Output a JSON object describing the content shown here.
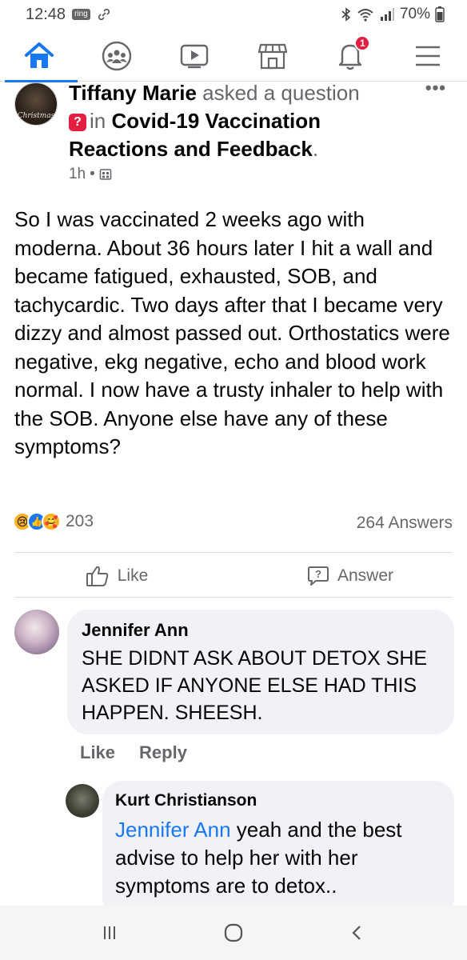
{
  "status_bar": {
    "time": "12:48",
    "ring_label": "ring",
    "battery": "70%"
  },
  "nav": {
    "tabs": [
      {
        "name": "home",
        "icon": "home-icon",
        "active": true
      },
      {
        "name": "groups",
        "icon": "groups-icon",
        "active": false
      },
      {
        "name": "watch",
        "icon": "video-icon",
        "active": false
      },
      {
        "name": "marketplace",
        "icon": "marketplace-icon",
        "active": false
      },
      {
        "name": "notifications",
        "icon": "bell-icon",
        "active": false
      },
      {
        "name": "menu",
        "icon": "menu-icon",
        "active": false
      }
    ],
    "notification_badge": "1"
  },
  "post": {
    "avatar_caption": "Christmas",
    "author": "Tiffany Marie",
    "action": "asked a question",
    "in_word": "in",
    "group": "Covid-19 Vaccination Reactions and Feedback",
    "time": "1h",
    "more": "•••",
    "body": "So I was vaccinated 2 weeks ago with moderna. About 36 hours later I hit a wall and became fatigued, exhausted, SOB, and tachycardic.  Two days after that I became very dizzy and almost passed out.  Orthostatics were negative, ekg negative, echo and blood work normal.  I now have a trusty inhaler to help with the SOB.  Anyone else have any of these symptoms?",
    "reaction_count": "203",
    "answers": "264 Answers",
    "like_label": "Like",
    "answer_label": "Answer"
  },
  "comments": [
    {
      "name": "Jennifer Ann",
      "text": "SHE DIDNT ASK ABOUT DETOX SHE ASKED IF ANYONE ELSE HAD THIS HAPPEN.  SHEESH.",
      "like_label": "Like",
      "reply_label": "Reply"
    },
    {
      "name": "Kurt Christianson",
      "mention": "Jennifer Ann",
      "text": " yeah and the best advise to help her with her symptoms are to detox.."
    }
  ],
  "colors": {
    "accent": "#1877f2",
    "badge": "#e41e3f",
    "muted": "#65676b",
    "bubble": "#f0f2f5"
  }
}
